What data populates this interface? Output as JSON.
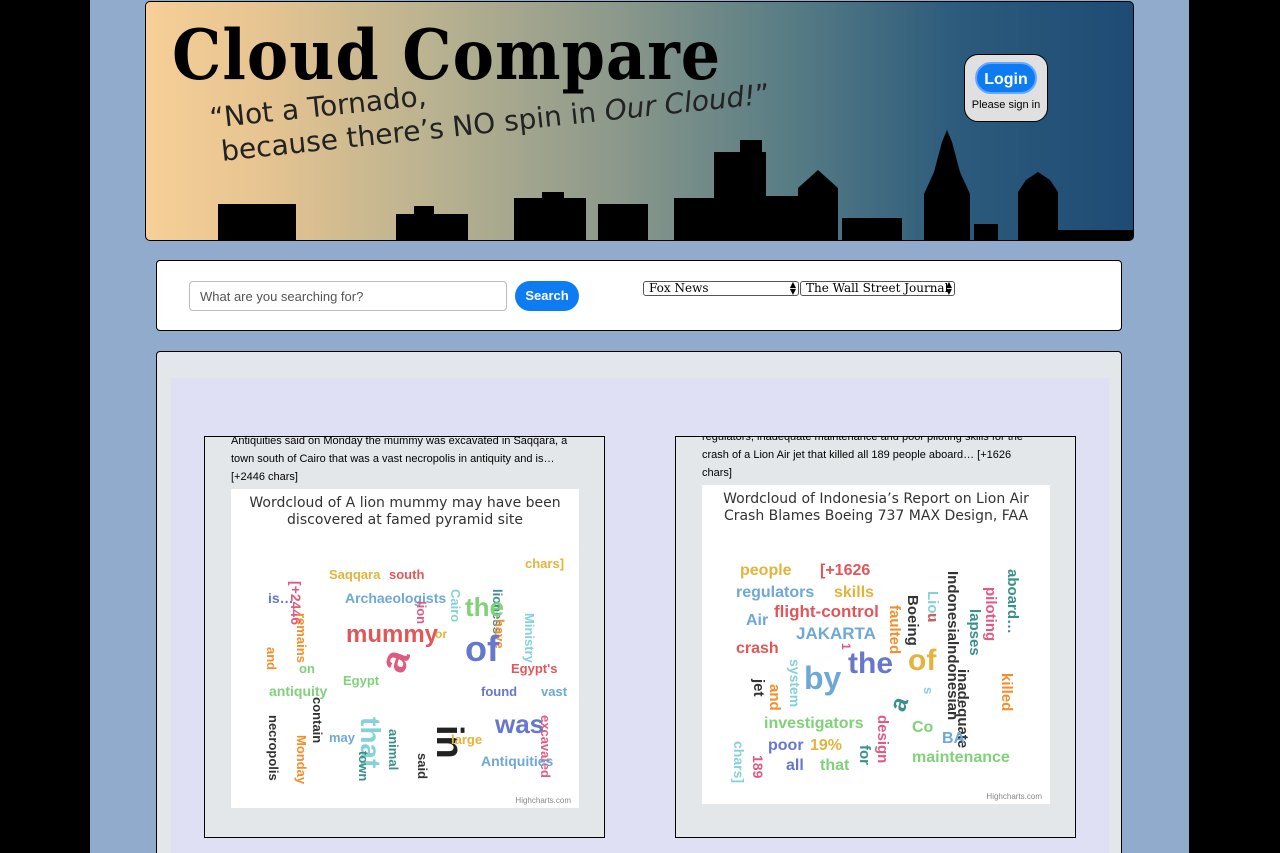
{
  "header": {
    "title": "Cloud Compare",
    "slogan_open": "“Not a Tornado,",
    "slogan_line2_a": "because there’s NO spin in ",
    "slogan_line2_em": "Our Cloud!",
    "slogan_close": "”",
    "login": {
      "button_label": "Login",
      "hint": "Please sign in"
    }
  },
  "search": {
    "placeholder": "What are you searching for?",
    "button_label": "Search",
    "source_a": "Fox News",
    "source_b": "The Wall Street Journal"
  },
  "colors": {
    "accent": "#0d7bf2",
    "page_bg": "#91abcc",
    "results_bg": "#e0e0f5"
  },
  "results": [
    {
      "snippet": "Antiquities said on Monday the mummy was excavated in Saqqara, a town south of Cairo that was a vast necropolis in antiquity and is… [+2446 chars]",
      "cloud_title": "Wordcloud of A lion mummy may have been discovered at famed pyramid site",
      "credits": "Highcharts.com",
      "words": [
        {
          "t": "[+2446",
          "c": "#e05a7f",
          "r": 90
        },
        {
          "t": "Saqqara",
          "c": "#e4b33b",
          "r": 0
        },
        {
          "t": "south",
          "c": "#e15759",
          "r": 0
        },
        {
          "t": "Cairo",
          "c": "#86d1d9",
          "r": 90
        },
        {
          "t": "lioness",
          "c": "#3a8f8a",
          "r": 90
        },
        {
          "t": "chars]",
          "c": "#e4b33b",
          "r": 0
        },
        {
          "t": "is…",
          "c": "#6677cc",
          "r": 0
        },
        {
          "t": "Archaeologists",
          "c": "#6ea8d6",
          "r": 0
        },
        {
          "t": "lion",
          "c": "#e05a7f",
          "r": 90
        },
        {
          "t": "the",
          "c": "#80d17a",
          "r": 0
        },
        {
          "t": "Ministry",
          "c": "#86d1d9",
          "r": 90
        },
        {
          "t": "remains",
          "c": "#f28e2b",
          "r": 90
        },
        {
          "t": "have",
          "c": "#f28e2b",
          "r": 90
        },
        {
          "t": "and",
          "c": "#f28e2b",
          "r": 90
        },
        {
          "t": "mummy",
          "c": "#e15759",
          "r": 0
        },
        {
          "t": "or",
          "c": "#e4b33b",
          "r": 0
        },
        {
          "t": "of",
          "c": "#6677cc",
          "r": 0
        },
        {
          "t": "on",
          "c": "#80d17a",
          "r": 0
        },
        {
          "t": "a",
          "c": "#e05a7f",
          "r": -70
        },
        {
          "t": "Egypt's",
          "c": "#e15759",
          "r": 0
        },
        {
          "t": "Egypt",
          "c": "#80d17a",
          "r": 0
        },
        {
          "t": "antiquity",
          "c": "#80d17a",
          "r": 0
        },
        {
          "t": "contain",
          "c": "#333333",
          "r": 90
        },
        {
          "t": "in",
          "c": "#222222",
          "r": 90
        },
        {
          "t": "found",
          "c": "#6677cc",
          "r": 0
        },
        {
          "t": "vast",
          "c": "#6ea8d6",
          "r": 0
        },
        {
          "t": "that",
          "c": "#86d1d9",
          "r": 90
        },
        {
          "t": "necropolis",
          "c": "#333333",
          "r": 90
        },
        {
          "t": "was",
          "c": "#6677cc",
          "r": 0
        },
        {
          "t": "excavated",
          "c": "#e05a7f",
          "r": 90
        },
        {
          "t": "may",
          "c": "#6ea8d6",
          "r": 0
        },
        {
          "t": "animal",
          "c": "#3a8f8a",
          "r": 90
        },
        {
          "t": "large",
          "c": "#e4b33b",
          "r": 0
        },
        {
          "t": "Monday",
          "c": "#f28e2b",
          "r": 90
        },
        {
          "t": "town",
          "c": "#3a8f8a",
          "r": 90
        },
        {
          "t": "said",
          "c": "#333333",
          "r": 90
        },
        {
          "t": "Antiquities",
          "c": "#6ea8d6",
          "r": 0
        }
      ]
    },
    {
      "snippet": "regulators, inadequate maintenance and poor piloting skills for the crash of a Lion Air jet that killed all 189 people aboard… [+1626 chars]",
      "cloud_title": "Wordcloud of Indonesia’s Report on Lion Air Crash Blames Boeing 737 MAX Design, FAA",
      "credits": "Highcharts.com",
      "words": [
        {
          "t": "people",
          "c": "#e4b33b",
          "r": 0
        },
        {
          "t": "[+1626",
          "c": "#e15759",
          "r": 0
        },
        {
          "t": "Boeing",
          "c": "#333333",
          "r": 90
        },
        {
          "t": "Lion",
          "c": "#86d1d9",
          "r": 90
        },
        {
          "t": "Indonesialndonesian",
          "c": "#333333",
          "r": 90
        },
        {
          "t": "piloting",
          "c": "#e05a7f",
          "r": 90
        },
        {
          "t": "aboard…",
          "c": "#3a8f8a",
          "r": 90
        },
        {
          "t": "regulators",
          "c": "#6ea8d6",
          "r": 0
        },
        {
          "t": "skills",
          "c": "#e4b33b",
          "r": 0
        },
        {
          "t": "faulted",
          "c": "#f28e2b",
          "r": 90
        },
        {
          "t": "u",
          "c": "#e15759",
          "r": 90
        },
        {
          "t": "lapses",
          "c": "#3a8f8a",
          "r": 90
        },
        {
          "t": "Air",
          "c": "#6ea8d6",
          "r": 0
        },
        {
          "t": "flight-control",
          "c": "#e15759",
          "r": 0
        },
        {
          "t": "JAKARTA",
          "c": "#6ea8d6",
          "r": 0
        },
        {
          "t": "crash",
          "c": "#e15759",
          "r": 0
        },
        {
          "t": "1",
          "c": "#e05a7f",
          "r": 90
        },
        {
          "t": "system",
          "c": "#86d1d9",
          "r": 90
        },
        {
          "t": "the",
          "c": "#6677cc",
          "r": 0
        },
        {
          "t": "of",
          "c": "#e4b33b",
          "r": 0
        },
        {
          "t": "killed",
          "c": "#f28e2b",
          "r": 90
        },
        {
          "t": "inadequate",
          "c": "#333333",
          "r": 90
        },
        {
          "t": "jet",
          "c": "#333333",
          "r": 90
        },
        {
          "t": "and",
          "c": "#f28e2b",
          "r": 90
        },
        {
          "t": "by",
          "c": "#6ea8d6",
          "r": 0
        },
        {
          "t": "s",
          "c": "#86d1d9",
          "r": 90
        },
        {
          "t": "a",
          "c": "#3a8f8a",
          "r": -70
        },
        {
          "t": "investigators",
          "c": "#80d17a",
          "r": 0
        },
        {
          "t": "design",
          "c": "#e05a7f",
          "r": 90
        },
        {
          "t": "Co",
          "c": "#80d17a",
          "r": 0
        },
        {
          "t": "BA",
          "c": "#6ea8d6",
          "r": 0
        },
        {
          "t": "chars]",
          "c": "#86d1d9",
          "r": 90
        },
        {
          "t": "poor",
          "c": "#6677cc",
          "r": 0
        },
        {
          "t": "19%",
          "c": "#e4b33b",
          "r": 0
        },
        {
          "t": "for",
          "c": "#3a8f8a",
          "r": 90
        },
        {
          "t": "189",
          "c": "#e05a7f",
          "r": 90
        },
        {
          "t": "all",
          "c": "#6677cc",
          "r": 0
        },
        {
          "t": "that",
          "c": "#80d17a",
          "r": 0
        },
        {
          "t": "maintenance",
          "c": "#80d17a",
          "r": 0
        }
      ]
    }
  ]
}
